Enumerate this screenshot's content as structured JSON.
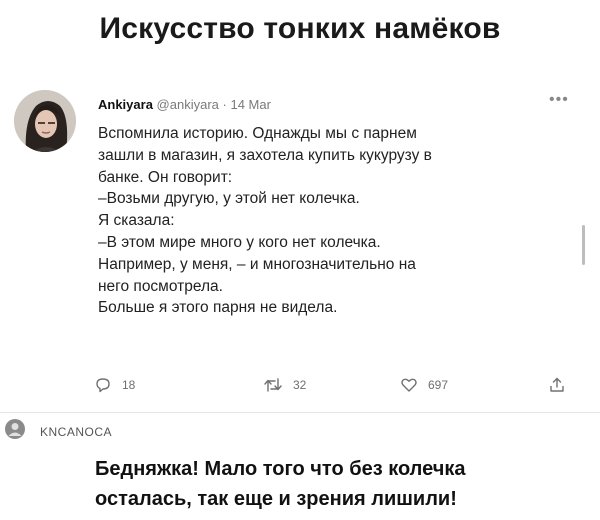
{
  "headline": "Искусство тонких намёков",
  "tweet": {
    "author_name": "Ankiyara",
    "author_handle": "@ankiyara",
    "separator": "·",
    "date": "14 Mar",
    "more_icon": "more-dots-icon",
    "lines": [
      "Вспомнила историю. Однажды мы с парнем",
      "зашли в магазин, я захотела купить кукурузу в",
      "банке. Он говорит:",
      "–Возьми другую, у этой нет колечка.",
      "Я сказала:",
      "–В этом мире много у кого нет колечка.",
      "Например, у меня, – и многозначительно на",
      "него посмотрела.",
      "Больше я этого парня не видела."
    ],
    "actions": {
      "reply": {
        "icon": "reply-icon",
        "count": "18"
      },
      "retweet": {
        "icon": "retweet-icon",
        "count": "32"
      },
      "like": {
        "icon": "like-icon",
        "count": "697"
      },
      "share": {
        "icon": "share-icon"
      }
    }
  },
  "comment": {
    "author": "KNCANOCA",
    "lines": [
      "Бедняжка! Мало того что без колечка",
      "осталась, так еще и зрения лишили!"
    ]
  },
  "colors": {
    "text": "#111111",
    "muted": "#707070",
    "divider": "#e6e6e6"
  }
}
